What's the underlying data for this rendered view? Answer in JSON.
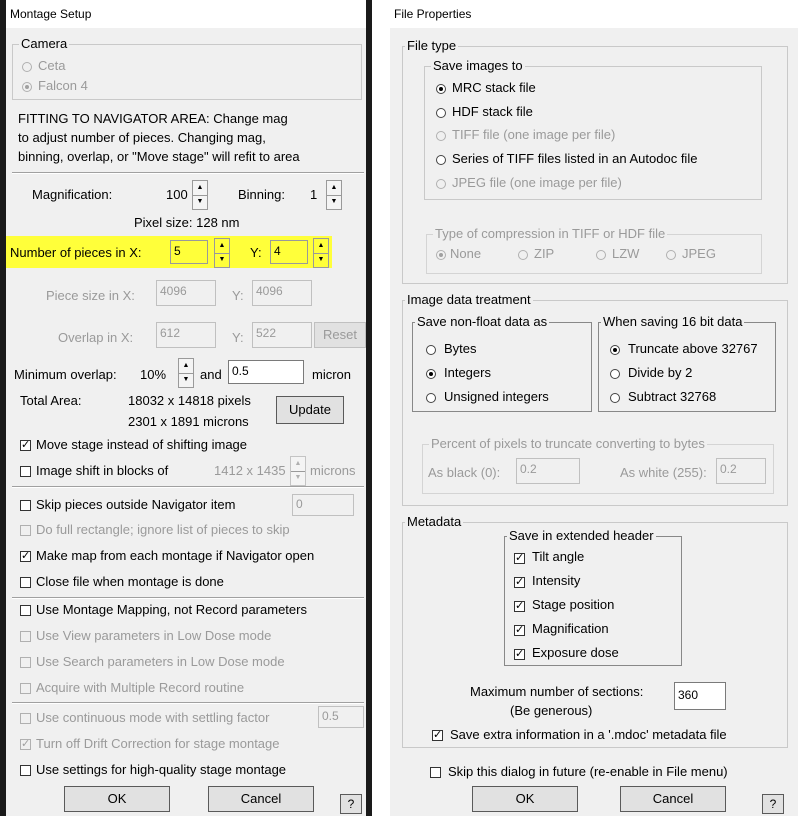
{
  "montage": {
    "title": "Montage Setup",
    "camera_group": "Camera",
    "camera_options": [
      "Ceta",
      "Falcon 4"
    ],
    "fit_text": [
      "FITTING TO NAVIGATOR AREA: Change mag",
      "to adjust number of pieces.  Changing mag,",
      "binning, overlap, or \"Move stage\" will refit to area"
    ],
    "mag_label": "Magnification:",
    "mag_value": "100",
    "binning_label": "Binning:",
    "binning_value": "1",
    "pixel_size": "Pixel size: 128 nm",
    "pieces_x_label": "Number of pieces in X:",
    "pieces_x_value": "5",
    "pieces_y_label": "Y:",
    "pieces_y_value": "4",
    "piece_size_label": "Piece size in X:",
    "piece_size_x": "4096",
    "piece_size_y_label": "Y:",
    "piece_size_y": "4096",
    "overlap_label": "Overlap in X:",
    "overlap_x": "612",
    "overlap_y_label": "Y:",
    "overlap_y": "522",
    "reset_label": "Reset",
    "min_overlap_label": "Minimum overlap:",
    "min_overlap_pct": "10%",
    "and_label": "and",
    "min_overlap_micron": "0.5",
    "micron_label": "micron",
    "total_area_label": "Total Area:",
    "total_pixels": "18032 x 14818 pixels",
    "total_microns": "2301 x 1891 microns",
    "update_label": "Update",
    "move_stage_label": "Move stage instead of shifting image",
    "image_shift_label": "Image shift in blocks of",
    "image_shift_value": "1412 x 1435",
    "microns_label": "microns",
    "skip_outside_label": "Skip pieces outside Navigator item",
    "skip_outside_value": "0",
    "full_rect_label": "Do full rectangle; ignore list of pieces to skip",
    "make_map_label": "Make map from each montage if Navigator open",
    "close_file_label": "Close file when montage is done",
    "use_mapping_label": "Use Montage Mapping, not Record parameters",
    "use_view_label": "Use View parameters in Low Dose mode",
    "use_search_label": "Use Search parameters in Low Dose mode",
    "acquire_multi_label": "Acquire with Multiple Record routine",
    "continuous_label": "Use continuous mode with settling factor",
    "continuous_value": "0.5",
    "drift_label": "Turn off Drift Correction for stage montage",
    "hq_label": "Use settings for high-quality stage montage",
    "ok_label": "OK",
    "cancel_label": "Cancel",
    "help_label": "?"
  },
  "fileprops": {
    "title": "File Properties",
    "file_type_group": "File type",
    "save_images_group": "Save images to",
    "save_options": [
      "MRC stack file",
      "HDF stack file",
      "TIFF file (one image per file)",
      "Series of TIFF files listed in an Autodoc file",
      "JPEG file (one image per file)"
    ],
    "compression_group": "Type of compression in TIFF or HDF file",
    "compression_options": [
      "None",
      "ZIP",
      "LZW",
      "JPEG"
    ],
    "image_data_group": "Image data treatment",
    "nonfloat_group": "Save non-float data as",
    "nonfloat_options": [
      "Bytes",
      "Integers",
      "Unsigned integers"
    ],
    "sixteen_group": "When saving 16 bit data",
    "sixteen_options": [
      "Truncate above 32767",
      "Divide by 2",
      "Subtract 32768"
    ],
    "percent_group": "Percent of pixels to truncate converting to bytes",
    "as_black_label": "As black (0):",
    "as_black_value": "0.2",
    "as_white_label": "As white (255):",
    "as_white_value": "0.2",
    "metadata_group": "Metadata",
    "extended_group": "Save in extended header",
    "extended_options": [
      "Tilt angle",
      "Intensity",
      "Stage position",
      "Magnification",
      "Exposure dose"
    ],
    "max_sections_label": "Maximum number of sections:",
    "max_sections_sub": "(Be generous)",
    "max_sections_value": "360",
    "save_extra_label": "Save extra information in a '.mdoc' metadata file",
    "skip_dialog_label": "Skip this dialog in future (re-enable in File menu)",
    "ok_label": "OK",
    "cancel_label": "Cancel",
    "help_label": "?"
  },
  "colors": {
    "highlight": "#ffff3a",
    "dialog_bg": "#f0f0f0",
    "border_dark": "#1a1a1a"
  }
}
